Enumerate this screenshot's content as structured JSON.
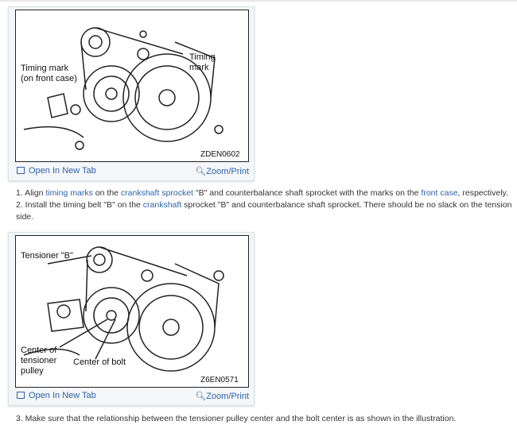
{
  "figures": [
    {
      "labels": [
        "Timing mark",
        "(on front case)",
        "Timing",
        "mark"
      ],
      "code": "ZDEN0602",
      "open_label": "Open In New Tab",
      "zoom_label": "Zoom/Print"
    },
    {
      "labels": [
        "Tensioner \"B\"",
        "Center of",
        "tensioner",
        "pulley",
        "Center of bolt"
      ],
      "code": "Z6EN0571",
      "open_label": "Open In New Tab",
      "zoom_label": "Zoom/Print"
    }
  ],
  "steps": {
    "s1": {
      "a": "1. Align ",
      "l1": "timing marks",
      "b": " on the ",
      "l2": "crankshaft sprocket",
      "c": " \"B\" and counterbalance shaft sprocket with the marks on the ",
      "l3": "front case",
      "d": ", respectively."
    },
    "s2": {
      "a": "2. Install the timing belt \"B\" on the ",
      "l1": "crankshaft",
      "b": " sprocket \"B\" and counterbalance shaft sprocket. There should be no slack on the tension side."
    },
    "s3": "3. Make sure that the relationship between the tensioner pulley center and the bolt center is as shown in the illustration."
  }
}
